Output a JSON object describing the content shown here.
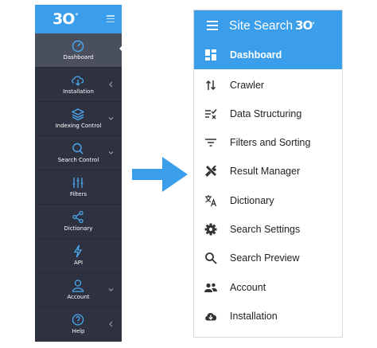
{
  "old_sidebar": {
    "logo": "3O",
    "logo_degree": "°",
    "items": [
      {
        "label": "Dashboard",
        "icon": "dashboard-gauge-icon",
        "active": true,
        "has_chevron": false
      },
      {
        "label": "Installation",
        "icon": "cloud-download-icon",
        "active": false,
        "has_chevron": true,
        "chevron": "chevron-left-icon"
      },
      {
        "label": "Indexing Control",
        "icon": "layers-icon",
        "active": false,
        "has_chevron": true,
        "chevron": "chevron-down-icon"
      },
      {
        "label": "Search Control",
        "icon": "search-icon",
        "active": false,
        "has_chevron": true,
        "chevron": "chevron-down-icon"
      },
      {
        "label": "Filters",
        "icon": "sliders-icon",
        "active": false,
        "has_chevron": false
      },
      {
        "label": "Dictionary",
        "icon": "share-icon",
        "active": false,
        "has_chevron": false
      },
      {
        "label": "API",
        "icon": "lightning-icon",
        "active": false,
        "has_chevron": false
      },
      {
        "label": "Account",
        "icon": "user-icon",
        "active": false,
        "has_chevron": true,
        "chevron": "chevron-down-icon"
      },
      {
        "label": "Help",
        "icon": "help-circle-icon",
        "active": false,
        "has_chevron": true,
        "chevron": "chevron-left-icon"
      }
    ]
  },
  "arrow": {
    "icon": "arrow-right-icon",
    "color": "#3a9eea"
  },
  "new_sidebar": {
    "title": "Site Search",
    "logo": "3O",
    "logo_degree": "°",
    "items": [
      {
        "label": "Dashboard",
        "icon": "dashboard-grid-icon",
        "active": true
      },
      {
        "label": "Crawler",
        "icon": "sort-arrows-icon",
        "active": false
      },
      {
        "label": "Data Structuring",
        "icon": "list-check-icon",
        "active": false
      },
      {
        "label": "Filters and Sorting",
        "icon": "filter-lines-icon",
        "active": false
      },
      {
        "label": "Result Manager",
        "icon": "tools-icon",
        "active": false
      },
      {
        "label": "Dictionary",
        "icon": "translate-icon",
        "active": false
      },
      {
        "label": "Search Settings",
        "icon": "gear-icon",
        "active": false
      },
      {
        "label": "Search Preview",
        "icon": "search-icon",
        "active": false
      },
      {
        "label": "Account",
        "icon": "people-icon",
        "active": false
      },
      {
        "label": "Installation",
        "icon": "cloud-download-icon",
        "active": false
      }
    ]
  },
  "colors": {
    "accent_blue": "#3a9eea",
    "old_sidebar_bg": "#2e3240",
    "old_sidebar_active_bg": "#4a4f5e",
    "new_text": "#222222"
  }
}
